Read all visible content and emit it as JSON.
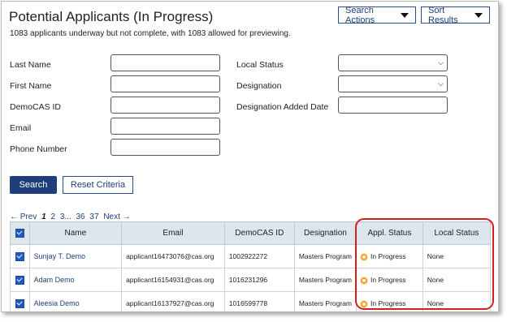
{
  "header": {
    "title": "Potential Applicants (In Progress)",
    "subtitle": "1083 applicants underway but not complete, with 1083 allowed for previewing.",
    "search_actions_label": "Search Actions",
    "sort_results_label": "Sort Results"
  },
  "form": {
    "last_name_label": "Last Name",
    "first_name_label": "First Name",
    "democas_id_label": "DemoCAS ID",
    "email_label": "Email",
    "phone_label": "Phone Number",
    "local_status_label": "Local Status",
    "designation_label": "Designation",
    "designation_added_date_label": "Designation Added Date",
    "search_button": "Search",
    "reset_button": "Reset Criteria"
  },
  "pager": {
    "prev": "← Prev",
    "current": "1",
    "page2": "2",
    "page3": "3",
    "ellipsis": "...",
    "page36": "36",
    "page37": "37",
    "next": "Next →"
  },
  "table": {
    "headers": [
      "Name",
      "Email",
      "DemoCAS ID",
      "Designation",
      "Appl. Status",
      "Local Status"
    ],
    "rows": [
      {
        "name": "Sunjay T. Demo",
        "email": "applicant16473076@cas.org",
        "id": "1002922272",
        "designation": "Masters Program",
        "appl_status": "In Progress",
        "local_status": "None"
      },
      {
        "name": "Adam Demo",
        "email": "applicant16154931@cas.org",
        "id": "1016231296",
        "designation": "Masters Program",
        "appl_status": "In Progress",
        "local_status": "None"
      },
      {
        "name": "Aleesia Demo",
        "email": "applicant16137927@cas.org",
        "id": "1016599778",
        "designation": "Masters Program",
        "appl_status": "In Progress",
        "local_status": "None"
      }
    ]
  },
  "colors": {
    "primary": "#1f3f7a",
    "header_bg": "#dce6ec",
    "highlight": "#d41f1f",
    "status_icon": "#f0a023"
  }
}
